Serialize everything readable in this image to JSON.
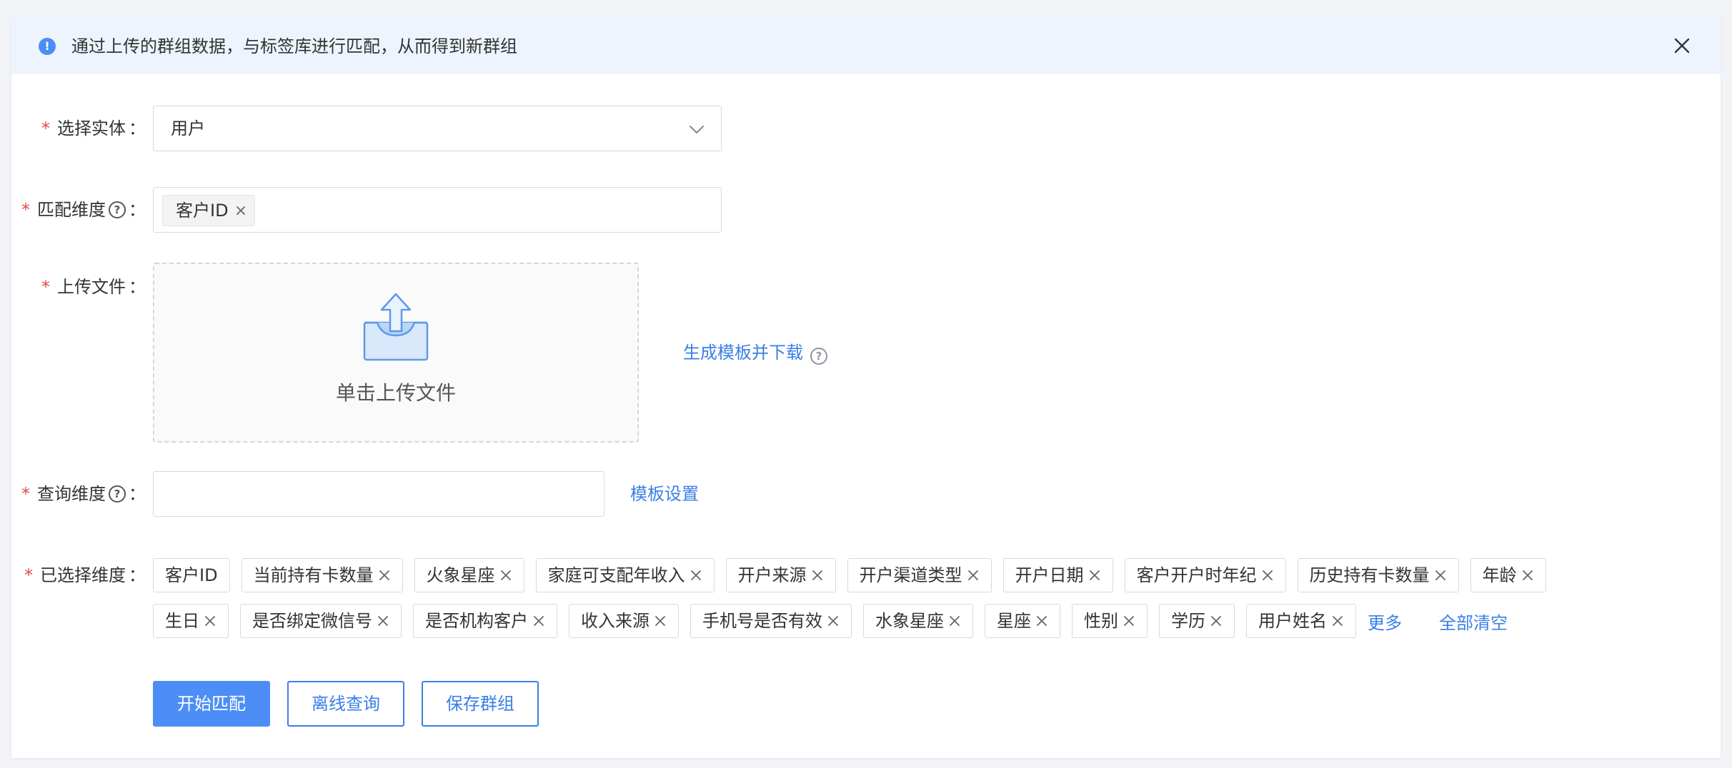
{
  "alert": {
    "text": "通过上传的群组数据，与标签库进行匹配，从而得到新群组",
    "icon": "info-icon"
  },
  "form": {
    "entity": {
      "label": "选择实体",
      "value": "用户"
    },
    "match_dimension": {
      "label": "匹配维度",
      "chips": [
        "客户ID"
      ]
    },
    "upload": {
      "label": "上传文件",
      "prompt": "单击上传文件",
      "template_link": "生成模板并下载"
    },
    "query_dimension": {
      "label": "查询维度",
      "value": "",
      "template_settings_link": "模板设置"
    },
    "selected_dimensions": {
      "label": "已选择维度",
      "row1": [
        "客户ID",
        "当前持有卡数量",
        "火象星座",
        "家庭可支配年收入",
        "开户来源",
        "开户渠道类型",
        "开户日期",
        "客户开户时年纪",
        "历史持有卡数量",
        "年龄"
      ],
      "row2": [
        "生日",
        "是否绑定微信号",
        "是否机构客户",
        "收入来源",
        "手机号是否有效",
        "水象星座",
        "星座",
        "性别",
        "学历",
        "用户姓名"
      ],
      "more_link": "更多",
      "clear_all_link": "全部清空"
    }
  },
  "buttons": {
    "start_match": "开始匹配",
    "offline_query": "离线查询",
    "save_group": "保存群组"
  },
  "colors": {
    "primary": "#4d8ef6",
    "link": "#3a7fe6",
    "required": "#e24a4a",
    "alert_bg": "#eef4fe"
  },
  "colon": "："
}
